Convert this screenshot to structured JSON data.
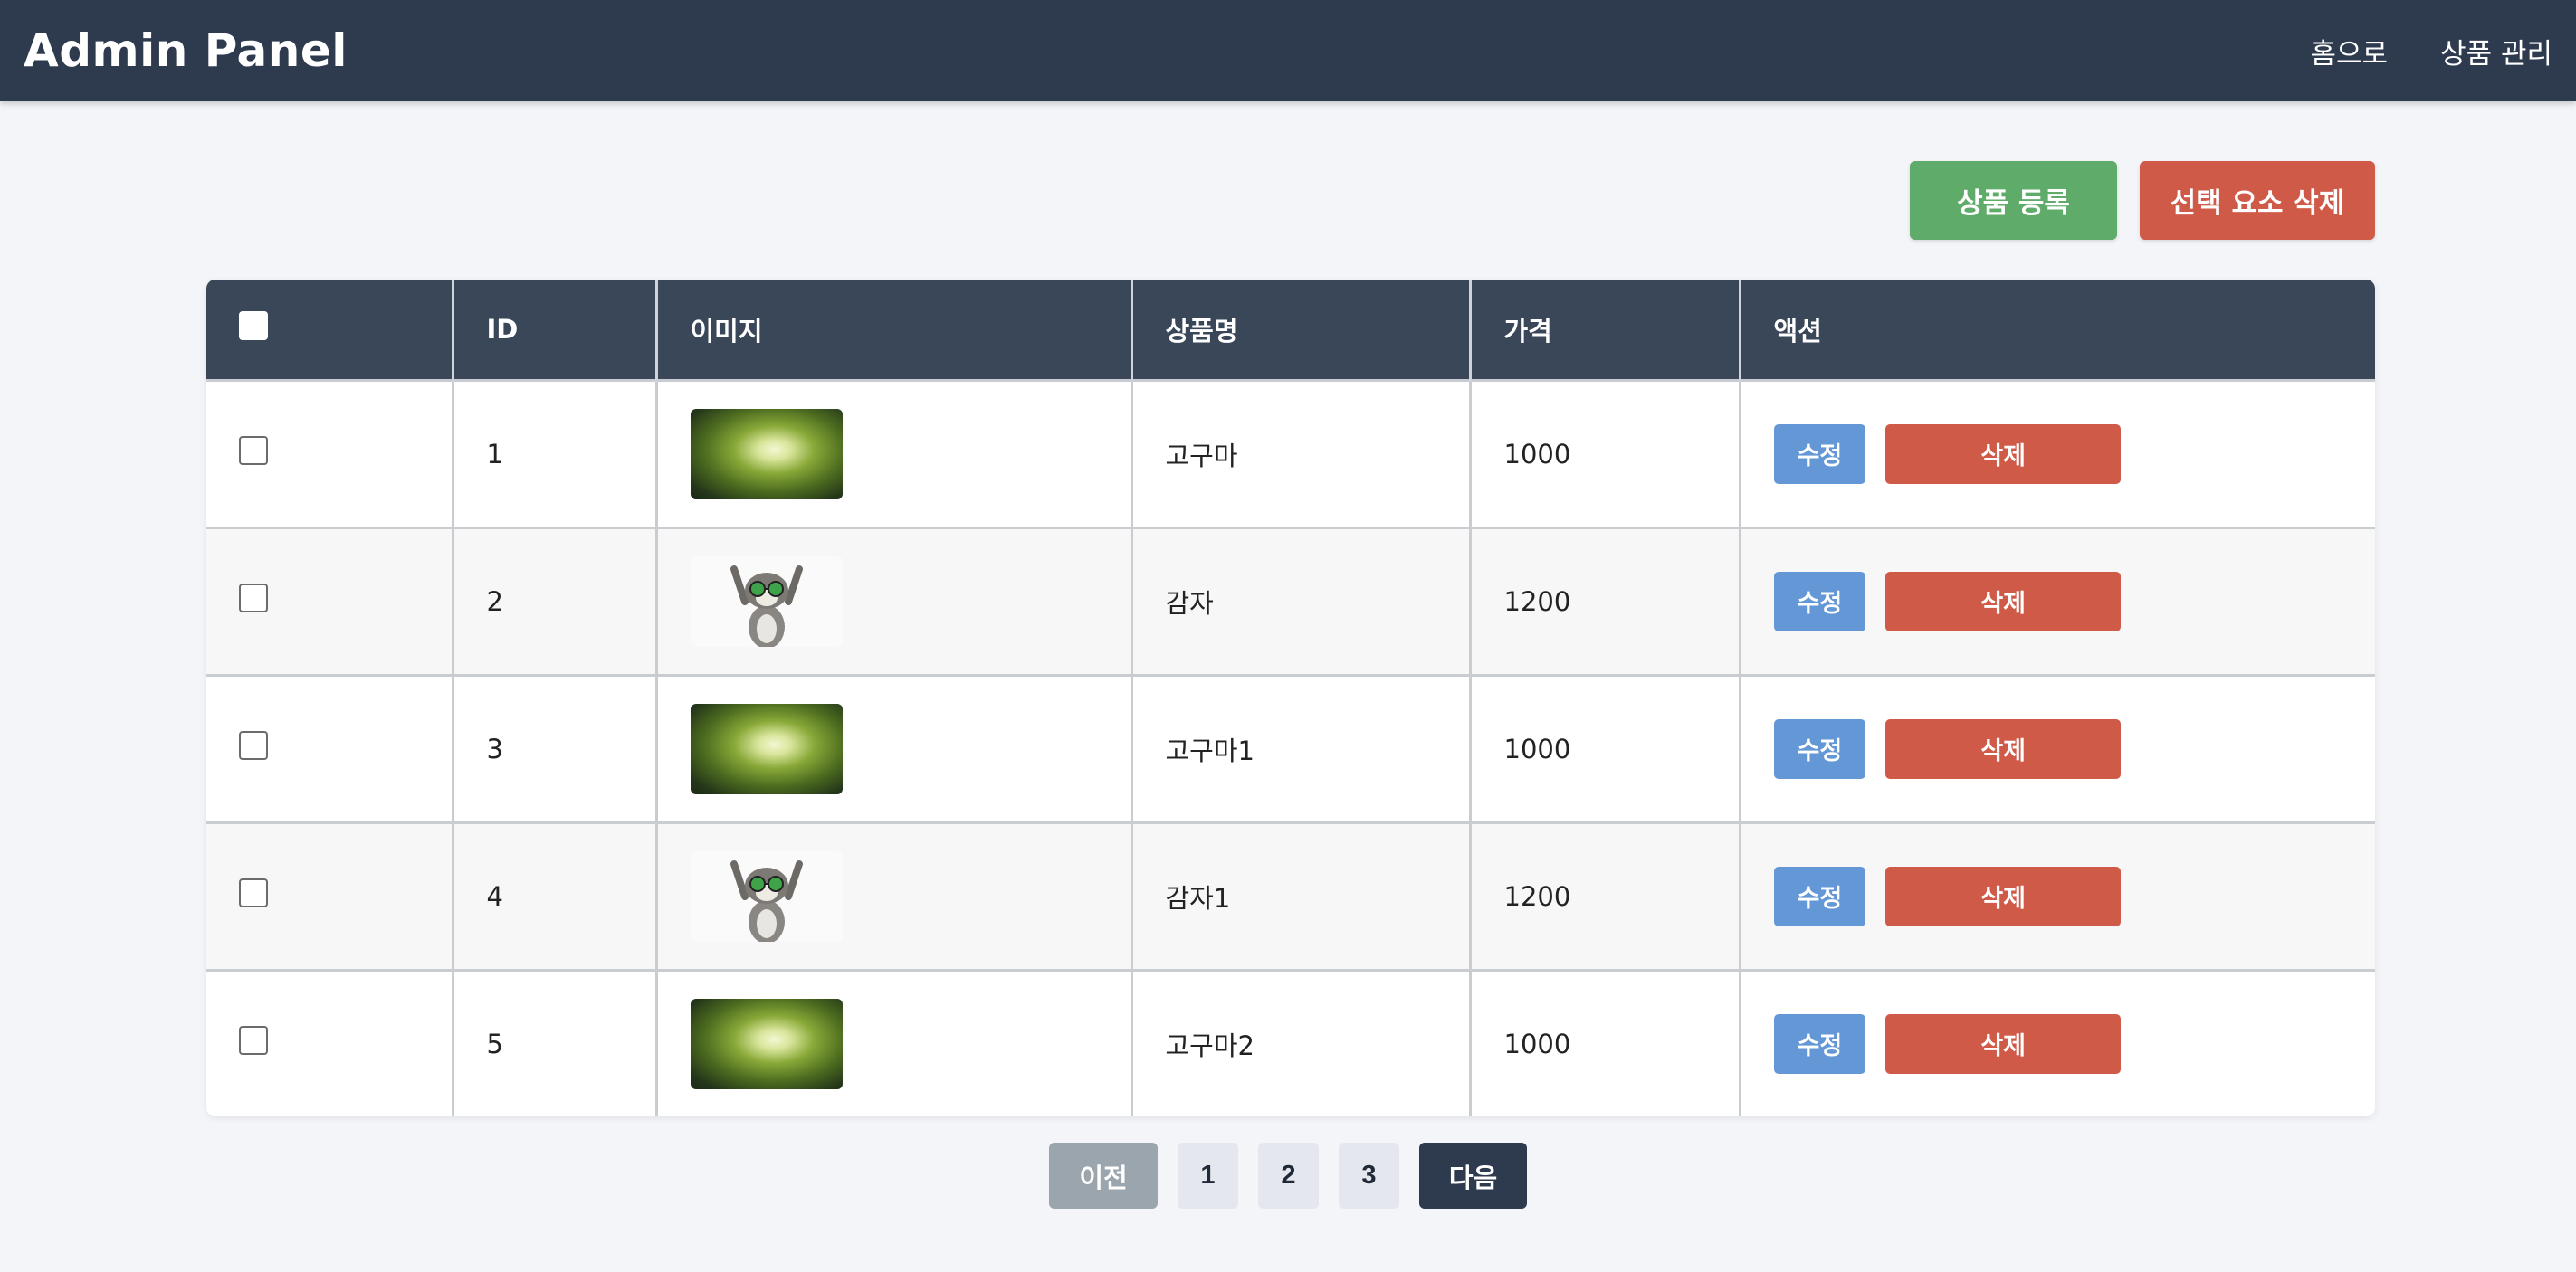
{
  "header": {
    "title": "Admin Panel",
    "nav": [
      "홈으로",
      "상품 관리"
    ]
  },
  "toolbar": {
    "register_label": "상품 등록",
    "delete_selected_label": "선택 요소 삭제"
  },
  "table": {
    "columns": [
      "",
      "ID",
      "이미지",
      "상품명",
      "가격",
      "액션"
    ],
    "rows": [
      {
        "id": "1",
        "image": "forest-canopy",
        "name": "고구마",
        "price": "1000"
      },
      {
        "id": "2",
        "image": "lemur",
        "name": "감자",
        "price": "1200"
      },
      {
        "id": "3",
        "image": "forest-canopy",
        "name": "고구마1",
        "price": "1000"
      },
      {
        "id": "4",
        "image": "lemur",
        "name": "감자1",
        "price": "1200"
      },
      {
        "id": "5",
        "image": "forest-canopy",
        "name": "고구마2",
        "price": "1000"
      }
    ],
    "edit_label": "수정",
    "delete_label": "삭제"
  },
  "pagination": {
    "prev_label": "이전",
    "pages": [
      "1",
      "2",
      "3"
    ],
    "next_label": "다음"
  },
  "colors": {
    "topbar": "#2e3a4d",
    "green": "#5fab6a",
    "red": "#d05a48",
    "blue": "#6497d6"
  }
}
